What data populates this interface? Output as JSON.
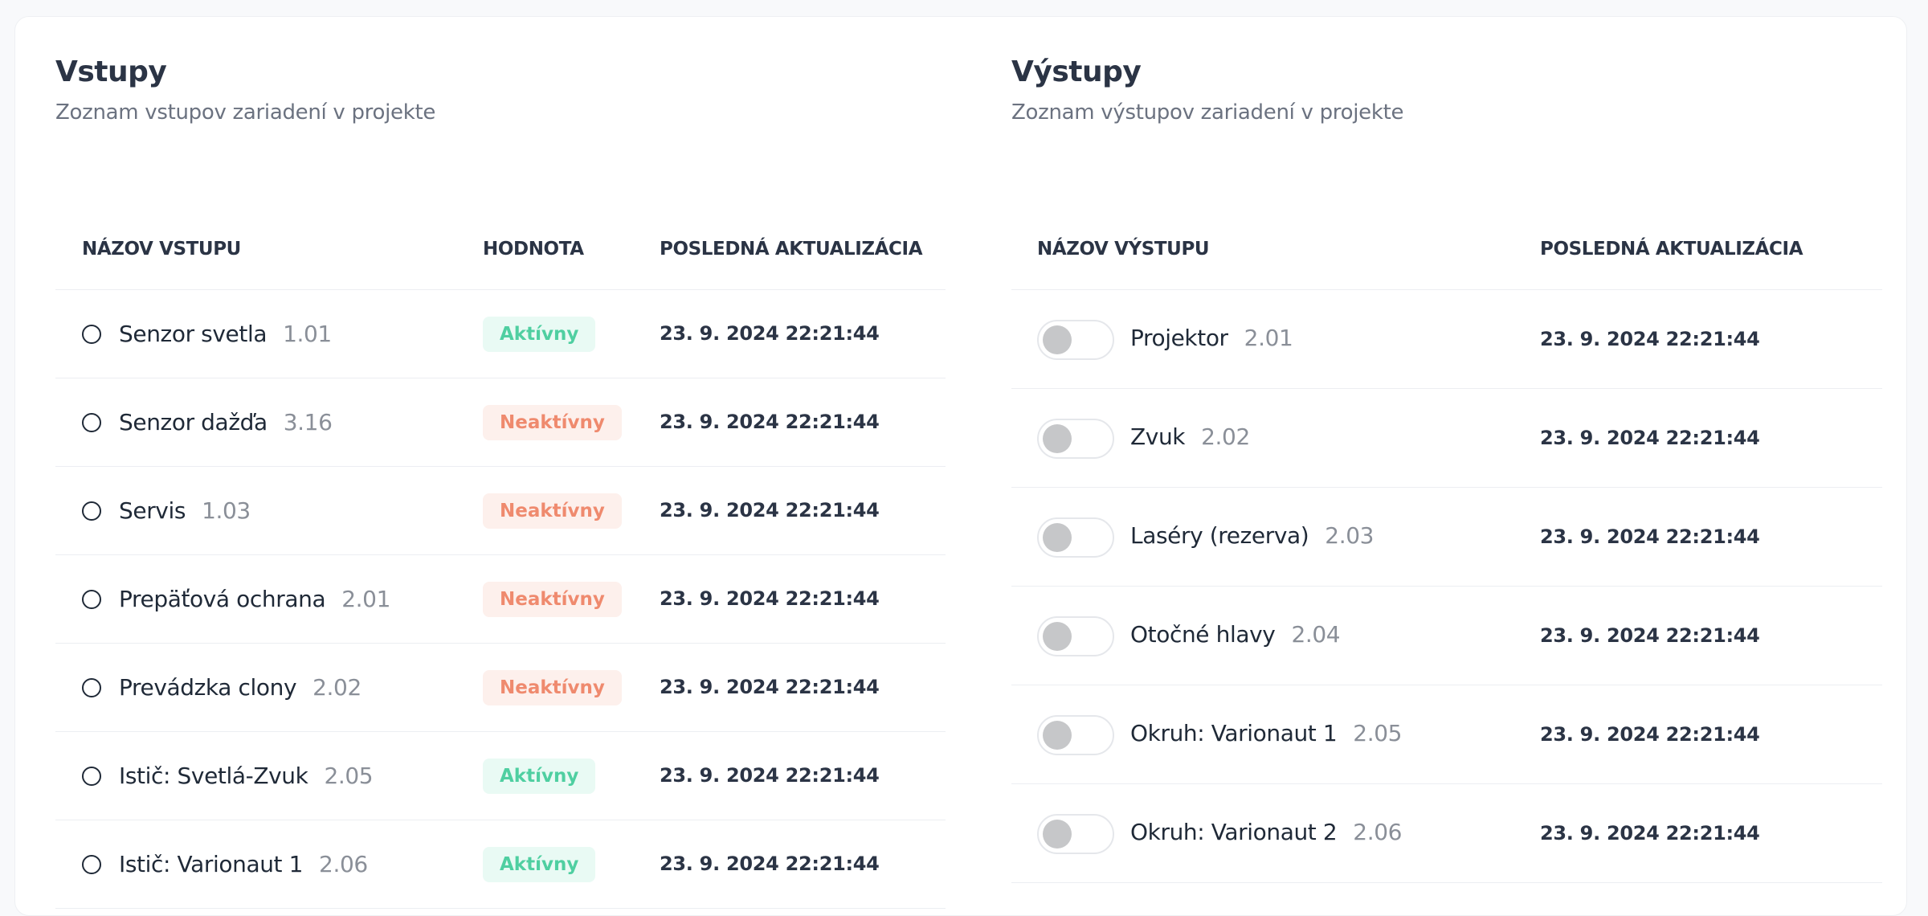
{
  "inputs": {
    "title": "Vstupy",
    "subtitle": "Zoznam vstupov zariadení v projekte",
    "columns": {
      "name": "NÁZOV VSTUPU",
      "value": "HODNOTA",
      "updated": "POSLEDNÁ AKTUALIZÁCIA"
    },
    "rows": [
      {
        "name": "Senzor svetla",
        "code": "1.01",
        "value": "Aktívny",
        "state": "active",
        "updated": "23. 9. 2024 22:21:44"
      },
      {
        "name": "Senzor dažďa",
        "code": "3.16",
        "value": "Neaktívny",
        "state": "inactive",
        "updated": "23. 9. 2024 22:21:44"
      },
      {
        "name": "Servis",
        "code": "1.03",
        "value": "Neaktívny",
        "state": "inactive",
        "updated": "23. 9. 2024 22:21:44"
      },
      {
        "name": "Prepäťová ochrana",
        "code": "2.01",
        "value": "Neaktívny",
        "state": "inactive",
        "updated": "23. 9. 2024 22:21:44"
      },
      {
        "name": "Prevádzka clony",
        "code": "2.02",
        "value": "Neaktívny",
        "state": "inactive",
        "updated": "23. 9. 2024 22:21:44"
      },
      {
        "name": "Istič: Svetlá-Zvuk",
        "code": "2.05",
        "value": "Aktívny",
        "state": "active",
        "updated": "23. 9. 2024 22:21:44"
      },
      {
        "name": "Istič: Varionaut 1",
        "code": "2.06",
        "value": "Aktívny",
        "state": "active",
        "updated": "23. 9. 2024 22:21:44"
      }
    ]
  },
  "outputs": {
    "title": "Výstupy",
    "subtitle": "Zoznam výstupov zariadení v projekte",
    "columns": {
      "name": "NÁZOV VÝSTUPU",
      "updated": "POSLEDNÁ AKTUALIZÁCIA"
    },
    "rows": [
      {
        "name": "Projektor",
        "code": "2.01",
        "on": false,
        "updated": "23. 9. 2024 22:21:44"
      },
      {
        "name": "Zvuk",
        "code": "2.02",
        "on": false,
        "updated": "23. 9. 2024 22:21:44"
      },
      {
        "name": "Laséry (rezerva)",
        "code": "2.03",
        "on": false,
        "updated": "23. 9. 2024 22:21:44"
      },
      {
        "name": "Otočné hlavy",
        "code": "2.04",
        "on": false,
        "updated": "23. 9. 2024 22:21:44"
      },
      {
        "name": "Okruh: Varionaut 1",
        "code": "2.05",
        "on": false,
        "updated": "23. 9. 2024 22:21:44"
      },
      {
        "name": "Okruh: Varionaut 2",
        "code": "2.06",
        "on": false,
        "updated": "23. 9. 2024 22:21:44"
      }
    ]
  },
  "colors": {
    "active_text": "#4fcfa1",
    "active_bg": "#e9faf4",
    "inactive_text": "#ef8a6e",
    "inactive_bg": "#fdf0ec",
    "toggle_off_knob": "#c6c7c9"
  },
  "icons": {
    "input_state": "radio-circle-icon",
    "output_control": "toggle-switch"
  }
}
